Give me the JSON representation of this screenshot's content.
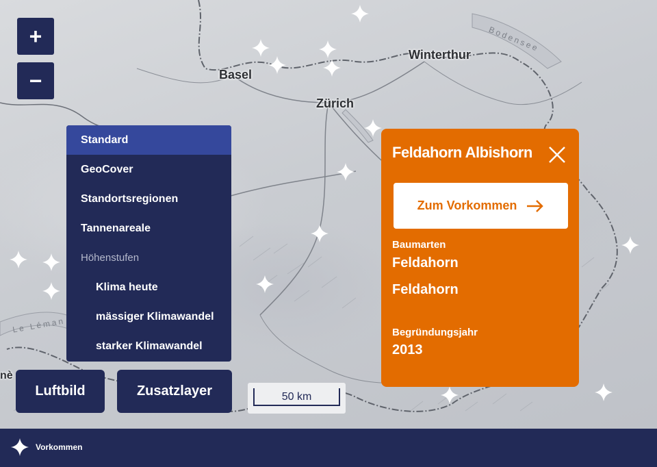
{
  "map": {
    "cities": [
      "Basel",
      "Zürich",
      "Winterthur"
    ],
    "lakes": [
      "Bodensee",
      "Le Léman"
    ],
    "edge_text": "nè"
  },
  "zoom": {
    "in_label": "+",
    "out_label": "−"
  },
  "layers": {
    "items": [
      {
        "label": "Standard",
        "kind": "item",
        "active": true
      },
      {
        "label": "GeoCover",
        "kind": "item"
      },
      {
        "label": "Standortsregionen",
        "kind": "item"
      },
      {
        "label": "Tannenareale",
        "kind": "item"
      },
      {
        "label": "Höhenstufen",
        "kind": "heading"
      },
      {
        "label": "Klima heute",
        "kind": "sub"
      },
      {
        "label": "mässiger Klimawandel",
        "kind": "sub"
      },
      {
        "label": "starker Klimawandel",
        "kind": "sub"
      }
    ]
  },
  "buttons": {
    "aerial": "Luftbild",
    "extra": "Zusatzlayer"
  },
  "scale": {
    "label": "50 km"
  },
  "popup": {
    "title": "Feldahorn Albishorn",
    "goto_label": "Zum Vorkommen",
    "species_label": "Baumarten",
    "species": [
      "Feldahorn",
      "Feldahorn"
    ],
    "year_label": "Begründungsjahr",
    "year": "2013"
  },
  "legend": {
    "label": "Vorkommen",
    "icon": "sparkle-star-icon"
  },
  "colors": {
    "navy": "#222a57",
    "active": "#35489c",
    "orange": "#e36c00"
  }
}
